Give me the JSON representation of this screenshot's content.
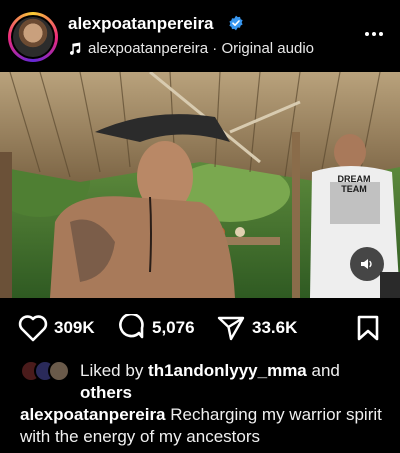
{
  "post": {
    "username": "alexpoatanpereira",
    "audio_owner": "alexpoatanpereira",
    "audio_separator": " · ",
    "audio_label": "Original audio"
  },
  "media": {
    "shirt_text_line1": "DREAM",
    "shirt_text_line2": "TEAM"
  },
  "actions": {
    "likes_count": "309K",
    "comments_count": "5,076",
    "shares_count": "33.6K"
  },
  "liked_by": {
    "prefix": "Liked by ",
    "user": "th1andonlyyy_mma",
    "middle": " and",
    "others": "others"
  },
  "caption": {
    "username": "alexpoatanpereira",
    "text": " Recharging my warrior spirit with the energy of my ancestors"
  },
  "colors": {
    "background": "#000000",
    "verified_blue": "#3897f0",
    "text": "#ffffff"
  }
}
